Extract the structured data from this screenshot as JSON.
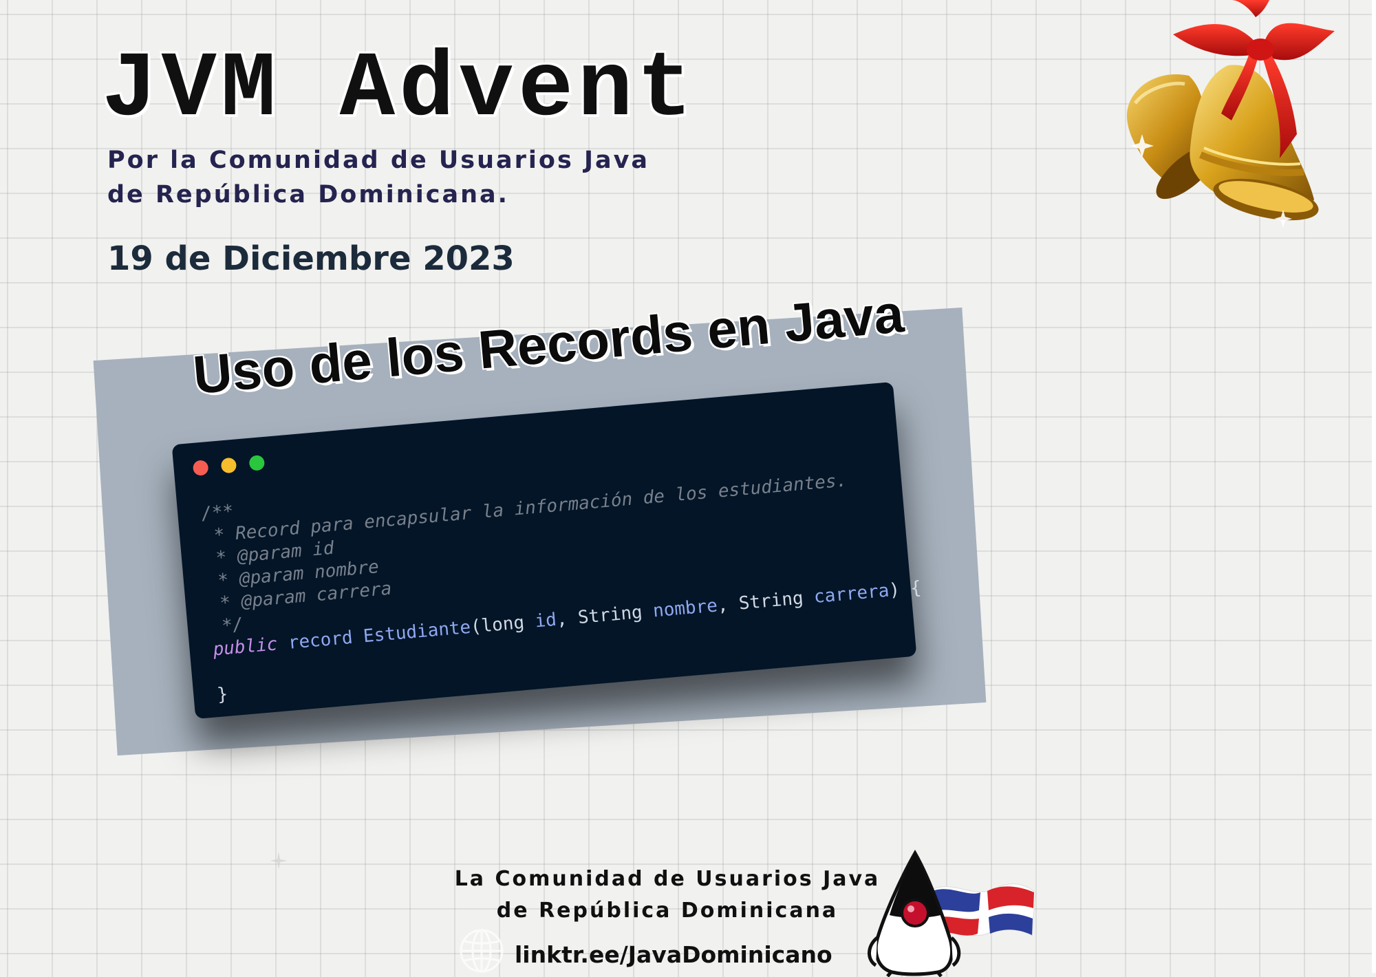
{
  "header": {
    "title": "JVM Advent",
    "subtitle_line1": "Por la Comunidad de Usuarios Java",
    "subtitle_line2": "de República Dominicana.",
    "date": "19 de Diciembre 2023"
  },
  "card": {
    "heading": "Uso de los Records en Java",
    "code": {
      "comment_lines": [
        "/**",
        " * Record para encapsular la información de los estudiantes.",
        " * @param id",
        " * @param nombre",
        " * @param carrera",
        " */"
      ],
      "keyword_public": "public",
      "keyword_record": "record",
      "type_name": "Estudiante",
      "paren_open": "(",
      "type_long": "long",
      "param_id": "id",
      "comma1": ", ",
      "type_string1": "String",
      "param_nombre": "nombre",
      "comma2": ", ",
      "type_string2": "String",
      "param_carrera": "carrera",
      "paren_close_brace": ") {",
      "closing_brace": "}"
    },
    "window_dots": [
      "red",
      "yellow",
      "green"
    ]
  },
  "footer": {
    "line1": "La Comunidad de Usuarios Java",
    "line2": "de República Dominicana",
    "link": "linktr.ee/JavaDominicano",
    "link_icon": "globe-icon"
  },
  "decorations": {
    "top_right": "christmas-bells-icon",
    "bottom": "duke-mascot-with-flag"
  },
  "colors": {
    "background": "#f1f1ef",
    "subtitle": "#25234f",
    "date": "#1c2b3b",
    "card_background": "#a6b1bd",
    "code_background": "#031527",
    "code_comment": "#78808c",
    "code_keyword": "#c68fe8",
    "code_type": "#8fa8f0"
  }
}
